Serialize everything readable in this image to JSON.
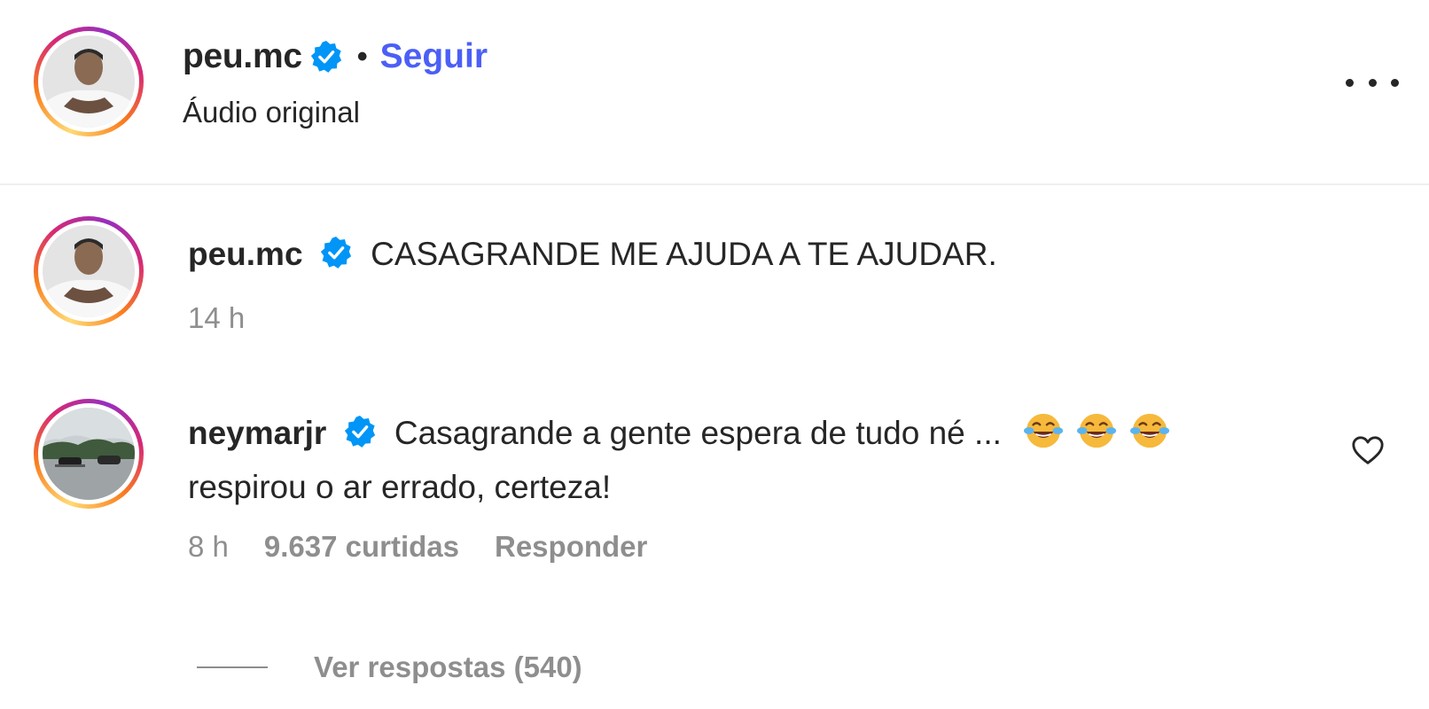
{
  "header": {
    "username": "peu.mc",
    "separator": "•",
    "follow_label": "Seguir",
    "subtitle": "Áudio original",
    "more_icon": "more-horizontal-icon"
  },
  "comments": [
    {
      "username": "peu.mc",
      "verified": true,
      "text": "CASAGRANDE ME AJUDA A TE AJUDAR.",
      "time": "14 h"
    },
    {
      "username": "neymarjr",
      "verified": true,
      "text_line1": "Casagrande a gente espera de tudo né ...",
      "emojis": [
        "😂",
        "😂",
        "😂"
      ],
      "text_line2": "respirou o ar errado, certeza!",
      "time": "8 h",
      "likes": "9.637 curtidas",
      "reply_label": "Responder",
      "like_icon": "heart-outline-icon"
    }
  ],
  "replies": {
    "label": "Ver respostas (540)"
  },
  "colors": {
    "text": "#262626",
    "muted": "#8e8e8e",
    "link": "#4b5ff6",
    "verified": "#0095f6"
  }
}
